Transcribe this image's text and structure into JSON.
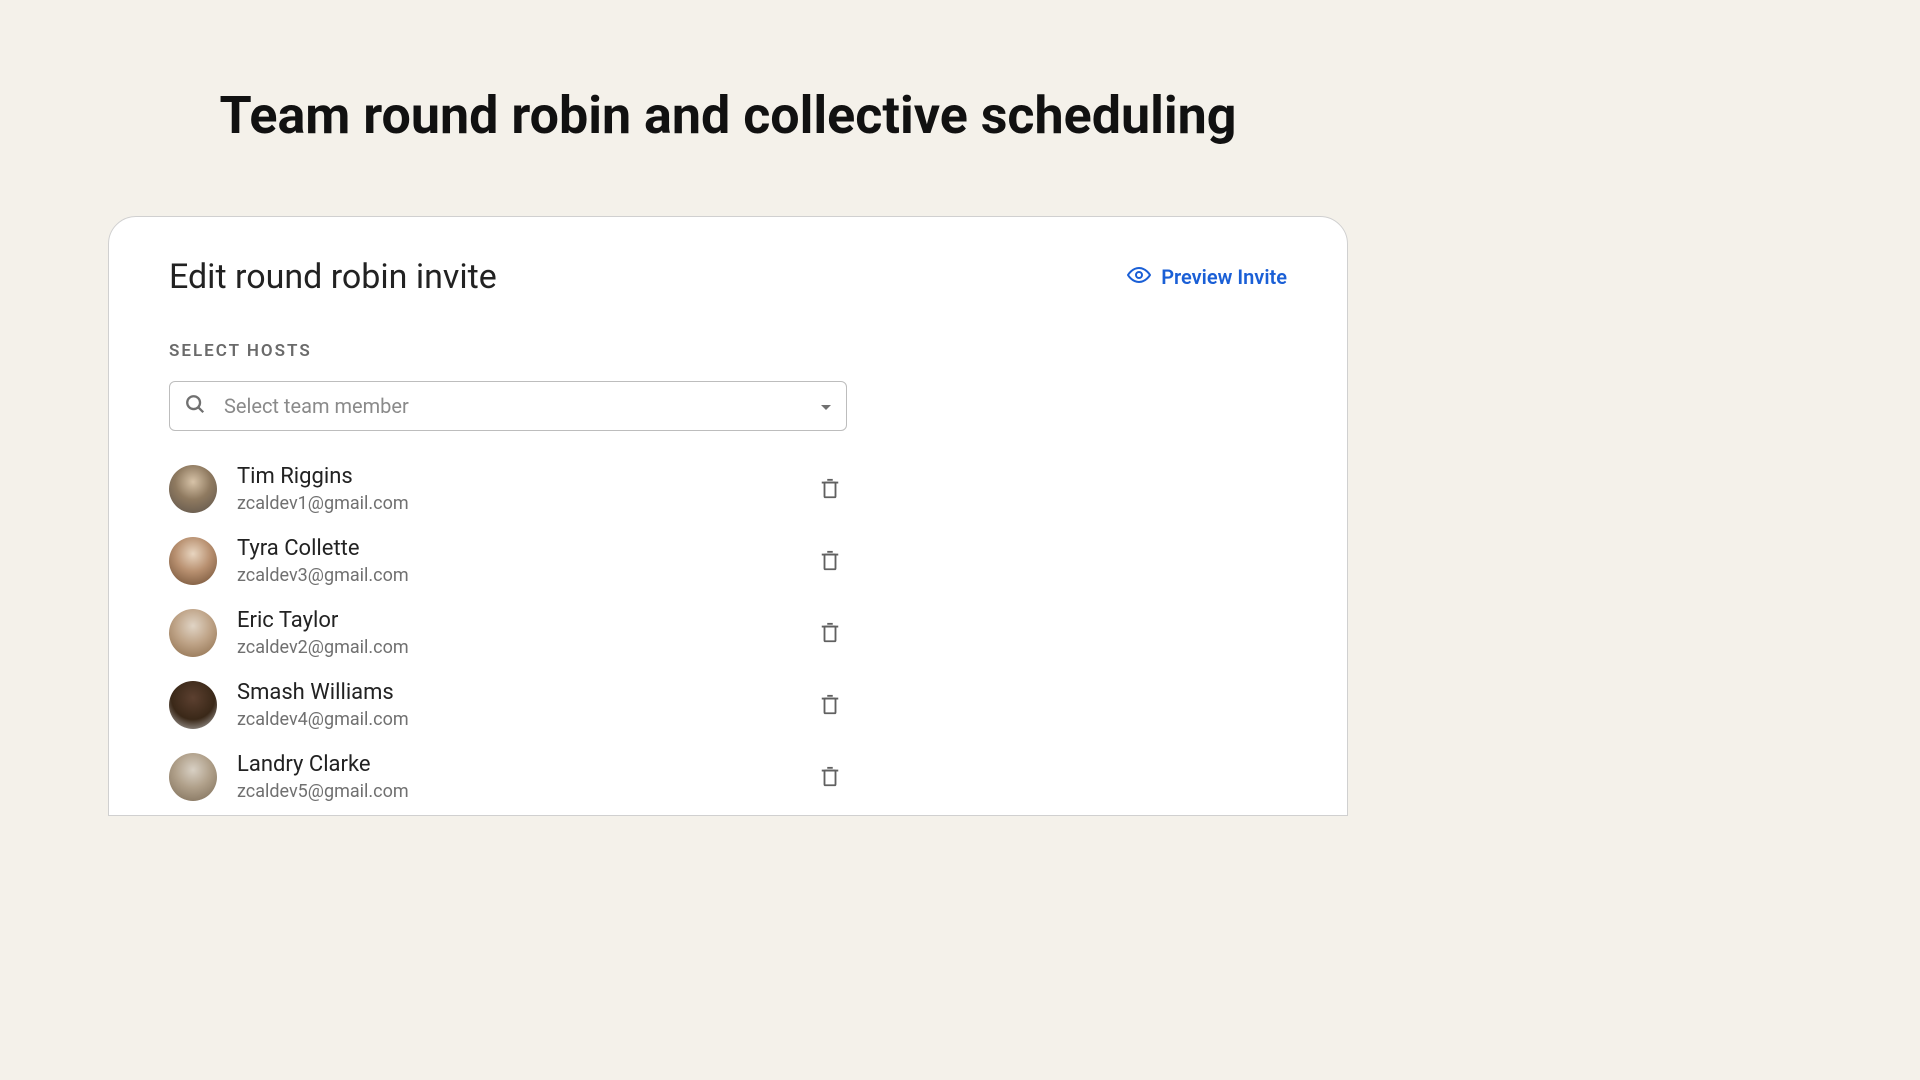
{
  "headline": "Team round robin and collective scheduling",
  "card": {
    "title": "Edit round robin invite",
    "preview_label": "Preview Invite",
    "section_label": "SELECT HOSTS",
    "select_placeholder": "Select team member"
  },
  "hosts": [
    {
      "name": "Tim Riggins",
      "email": "zcaldev1@gmail.com"
    },
    {
      "name": "Tyra Collette",
      "email": "zcaldev3@gmail.com"
    },
    {
      "name": "Eric Taylor",
      "email": "zcaldev2@gmail.com"
    },
    {
      "name": "Smash Williams",
      "email": "zcaldev4@gmail.com"
    },
    {
      "name": "Landry Clarke",
      "email": "zcaldev5@gmail.com"
    }
  ]
}
